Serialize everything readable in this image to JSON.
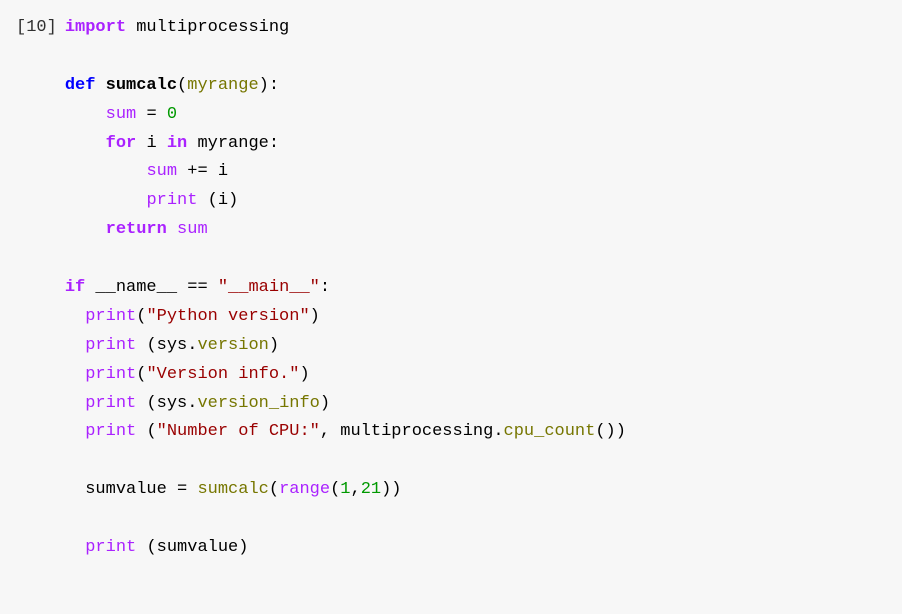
{
  "cell": {
    "execution_count": "[10]",
    "code": {
      "l1": {
        "kw": "import",
        "mod": "multiprocessing"
      },
      "l3": {
        "kw": "def",
        "fn": "sumcalc",
        "param": "myrange"
      },
      "l4": {
        "var": "sum",
        "eq": "=",
        "val": "0"
      },
      "l5": {
        "kw1": "for",
        "var": "i",
        "kw2": "in",
        "iter": "myrange"
      },
      "l6": {
        "expr_left": "sum",
        "op": "+=",
        "expr_right": "i"
      },
      "l7": {
        "fn": "print",
        "arg": "i"
      },
      "l8": {
        "kw": "return",
        "var": "sum"
      },
      "l10": {
        "kw": "if",
        "dunder": "__name__",
        "eq": "==",
        "str": "\"__main__\""
      },
      "l11": {
        "fn": "print",
        "str": "\"Python version\""
      },
      "l12": {
        "fn": "print",
        "obj": "sys",
        "attr": "version"
      },
      "l13": {
        "fn": "print",
        "str": "\"Version info.\""
      },
      "l14": {
        "fn": "print",
        "obj": "sys",
        "attr": "version_info"
      },
      "l15": {
        "fn": "print",
        "str": "\"Number of CPU:\"",
        "comma": ",",
        "obj": "multiprocessing",
        "attr": "cpu_count"
      },
      "l17": {
        "var": "sumvalue",
        "eq": "=",
        "fn": "sumcalc",
        "rng": "range",
        "a": "1",
        "b": "21"
      },
      "l19": {
        "fn": "print",
        "arg": "sumvalue"
      }
    }
  }
}
